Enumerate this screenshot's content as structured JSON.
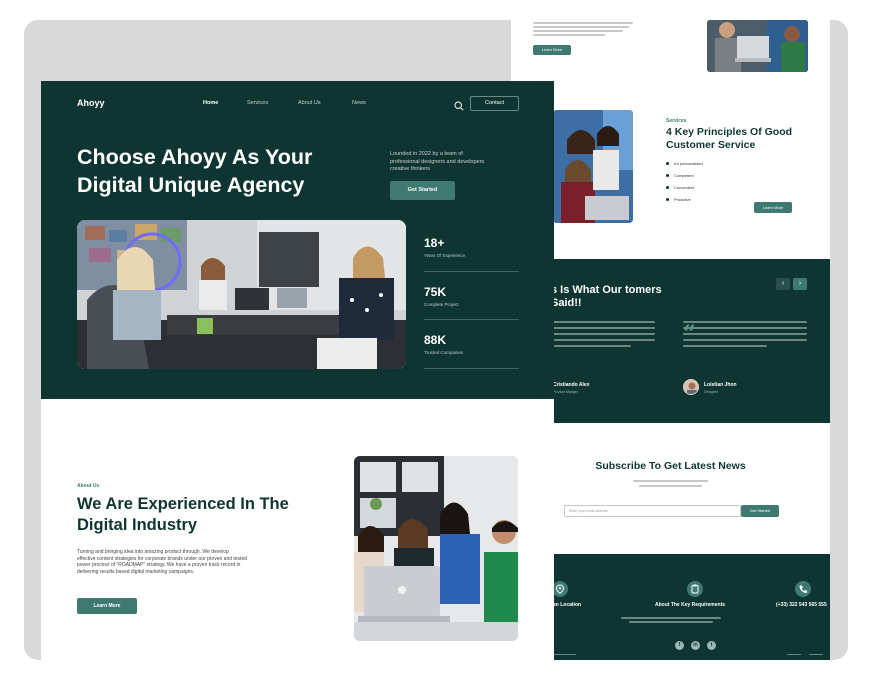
{
  "colors": {
    "dark_green": "#0f3533",
    "accent_green": "#3f7a72",
    "backdrop": "#d9d9d9"
  },
  "front": {
    "logo": "Ahoyy",
    "nav": [
      "Home",
      "Services",
      "About Us",
      "News"
    ],
    "contact_label": "Contact",
    "search_icon": "search-icon",
    "hero_title": "Choose Ahoyy As  Your Digital Unique Agency",
    "hero_description": "Lounded in 2022 by a team of professional designers and developers creative thinkers",
    "get_started_label": "Get Started",
    "stats": [
      {
        "value": "18+",
        "label": "Years Of Experience"
      },
      {
        "value": "75K",
        "label": "Complete Project"
      },
      {
        "value": "88K",
        "label": "Trusted Companies"
      }
    ],
    "about": {
      "eyebrow": "About Us",
      "title": "We Are Experienced In The Digital Industry",
      "description": "Turning and bringing idea into amazing product through. We develop effective content strategies for corporate brands under our proven and tested power process of \"ROADMAP\" strategy. We have a proven track record in delivering results based digital marketing campaigns.",
      "learn_more_label": "Learn More"
    }
  },
  "back": {
    "top_learn_more": "Learn More",
    "key_principles": {
      "eyebrow": "Services",
      "title": "4 Key Principles Of Good Customer Service",
      "items": [
        "It's personalised",
        "Competent",
        "Convenient",
        "Proactive"
      ],
      "button_label": "Learn More"
    },
    "testimonials": {
      "title": "s Is What Our tomers Said!!",
      "prev_icon": "arrow-left-icon",
      "next_icon": "arrow-right-icon",
      "quote_icon": "quote-icon",
      "people": [
        {
          "name": "Cristiando Alex",
          "role": "Product Manger"
        },
        {
          "name": "Loistian Jhon",
          "role": "Designer"
        }
      ]
    },
    "subscribe": {
      "title": "Subscribe To Get Latest News",
      "input_placeholder": "Enter your email address",
      "button_label": "Get Started"
    },
    "footer": {
      "items": [
        {
          "icon": "location-icon",
          "label": "an Location"
        },
        {
          "icon": "clipboard-icon",
          "label": "About The Key Requirements"
        },
        {
          "icon": "phone-icon",
          "label": "(+33) 322 543 565 555"
        }
      ],
      "social_icons": [
        "facebook-icon",
        "linkedin-icon",
        "twitter-icon"
      ]
    }
  }
}
